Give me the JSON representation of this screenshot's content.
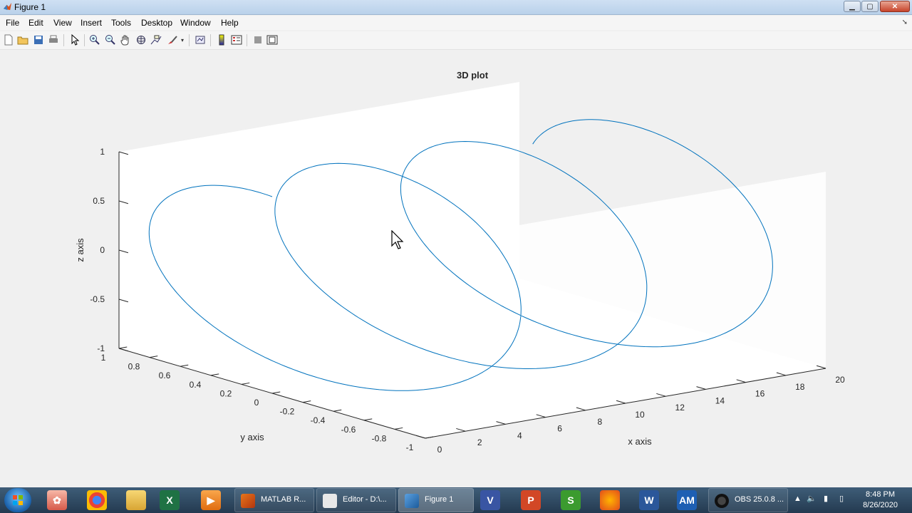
{
  "window": {
    "title": "Figure 1"
  },
  "menu": [
    "File",
    "Edit",
    "View",
    "Insert",
    "Tools",
    "Desktop",
    "Window",
    "Help"
  ],
  "toolbar_icons": [
    "new-figure-icon",
    "open-file-icon",
    "save-icon",
    "print-icon",
    "select-arrow-icon",
    "zoom-in-icon",
    "zoom-out-icon",
    "pan-hand-icon",
    "rotate-3d-icon",
    "data-cursor-icon",
    "brush-icon",
    "link-plot-icon",
    "colorbar-icon",
    "legend-icon",
    "hide-plot-tools-icon",
    "show-plot-tools-icon"
  ],
  "chart_data": {
    "type": "line",
    "title": "3D plot",
    "xlabel": "x axis",
    "ylabel": "y axis",
    "zlabel": "z axis",
    "xlim": [
      0,
      20
    ],
    "ylim": [
      -1,
      1
    ],
    "zlim": [
      -1,
      1
    ],
    "xticks": [
      "0",
      "2",
      "4",
      "6",
      "8",
      "10",
      "12",
      "14",
      "16",
      "18",
      "20"
    ],
    "yticks": [
      "-1",
      "-0.8",
      "-0.6",
      "-0.4",
      "-0.2",
      "0",
      "0.2",
      "0.4",
      "0.6",
      "0.8",
      "1"
    ],
    "zticks": [
      "-1",
      "-0.5",
      "0",
      "0.5",
      "1"
    ],
    "series": [
      {
        "x": "t",
        "y": "sin(t)",
        "z": "cos(t)",
        "t_range": [
          0,
          20
        ],
        "color": "#0072bd"
      }
    ],
    "grid": false
  },
  "taskbar": {
    "tasks": [
      {
        "label": "MATLAB R...",
        "icon": "matlab-icon"
      },
      {
        "label": "Editor - D:\\...",
        "icon": "editor-icon"
      },
      {
        "label": "Figure 1",
        "icon": "matlab-figure-icon"
      },
      {
        "label": "OBS 25.0.8 ...",
        "icon": "obs-icon"
      }
    ],
    "pinned": [
      "paint-icon",
      "chrome-icon",
      "folder-icon",
      "excel-icon",
      "media-player-icon",
      "visio-icon",
      "powerpoint-icon",
      "green-app-icon",
      "firefox-icon",
      "word-icon",
      "am-icon"
    ],
    "am_label": "AM",
    "time": "8:48 PM",
    "date": "8/26/2020"
  }
}
